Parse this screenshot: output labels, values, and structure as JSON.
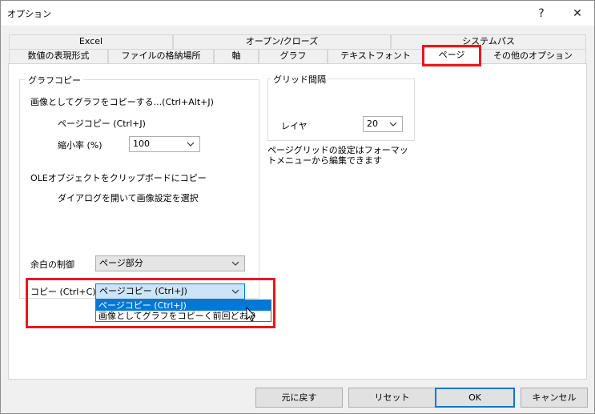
{
  "window": {
    "title": "オプション",
    "help": "?",
    "close": "✕"
  },
  "tabs_row1": [
    "Excel",
    "オープン/クローズ",
    "システムパス"
  ],
  "tabs_row2": [
    "数値の表現形式",
    "ファイルの格納場所",
    "軸",
    "グラフ",
    "テキストフォント",
    "ページ",
    "その他のオプション"
  ],
  "graph_copy": {
    "title": "グラフコピー",
    "copy_as_image": "画像としてグラフをコピーする...(Ctrl+Alt+J)",
    "page_copy": "ページコピー (Ctrl+J)",
    "scale_label": "縮小率 (%)",
    "scale_value": "100",
    "ole_copy": "OLEオブジェクトをクリップボードにコピー",
    "dialog_select": "ダイアログを開いて画像設定を選択",
    "margin_label": "余白の制御",
    "margin_value": "ページ部分",
    "copy_label": "コピー (Ctrl+C)",
    "copy_value": "ページコピー (Ctrl+J)",
    "dropdown_options": [
      "ページコピー (Ctrl+J)",
      "画像としてグラフをコピーく前回どおり"
    ]
  },
  "grid": {
    "title": "グリッド間隔",
    "layer_label": "レイヤ",
    "layer_value": "20",
    "note": "ページグリッドの設定はフォーマットメニューから編集できます"
  },
  "buttons": {
    "revert": "元に戻す",
    "reset": "リセット",
    "ok": "OK",
    "cancel": "キャンセル"
  },
  "colors": {
    "highlight": "#e8181e",
    "accent": "#0078d7"
  }
}
